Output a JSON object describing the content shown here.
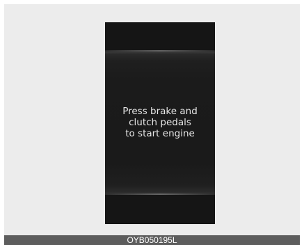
{
  "display": {
    "message_lines": [
      "Press brake and",
      "clutch pedals",
      "to start engine"
    ]
  },
  "figure": {
    "code": "OYB050195L"
  },
  "colors": {
    "display_background": "#161616",
    "display_text": "#e6e6e6",
    "frame_background": "#ececec",
    "code_bar": "#5d5d5d"
  }
}
